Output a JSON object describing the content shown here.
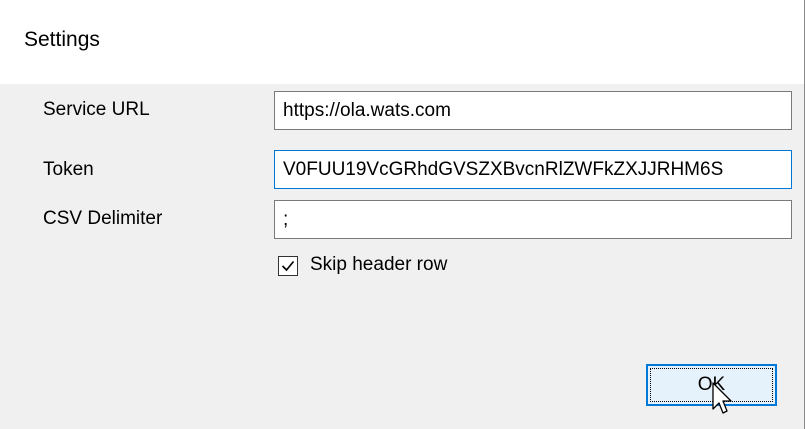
{
  "window": {
    "title": "Settings"
  },
  "form": {
    "service_url": {
      "label": "Service URL",
      "value": "https://ola.wats.com"
    },
    "token": {
      "label": "Token",
      "value": "V0FUU19VcGRhdGVSZXBvcnRlZWFkZXJJRHM6S"
    },
    "csv_delimiter": {
      "label": "CSV Delimiter",
      "value": ";"
    },
    "skip_header": {
      "label": "Skip header row",
      "checked": true
    }
  },
  "buttons": {
    "ok_label": "OK"
  },
  "colors": {
    "focus_border": "#0078d7",
    "button_bg": "#e5f1fb",
    "dialog_bg": "#f0f0f0"
  }
}
